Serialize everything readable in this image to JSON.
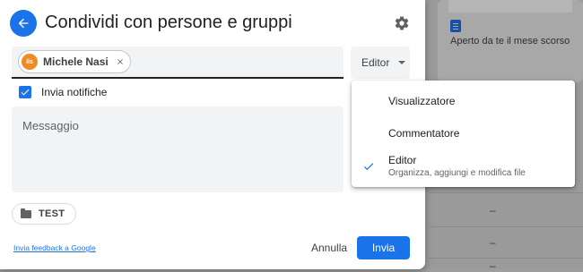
{
  "dialog": {
    "title": "Condividi con persone e gruppi"
  },
  "recipient": {
    "name": "Michele Nasi",
    "avatar_text": "ils"
  },
  "role_button": {
    "label": "Editor"
  },
  "notify": {
    "label": "Invia notifiche",
    "checked": true
  },
  "message": {
    "placeholder": "Messaggio"
  },
  "folder": {
    "label": "TEST"
  },
  "footer": {
    "feedback": "Invia feedback a Google",
    "cancel": "Annulla",
    "send": "Invia"
  },
  "role_menu": {
    "items": [
      {
        "label": "Visualizzatore",
        "description": "",
        "selected": false
      },
      {
        "label": "Commentatore",
        "description": "",
        "selected": false
      },
      {
        "label": "Editor",
        "description": "Organizza, aggiungi e modifica file",
        "selected": true
      }
    ]
  },
  "background": {
    "recent_card_text": "Aperto da te il mese scorso",
    "row_dashes": [
      "–",
      "–",
      "–"
    ]
  },
  "colors": {
    "accent": "#1a73e8",
    "avatar": "#ef8a24"
  }
}
